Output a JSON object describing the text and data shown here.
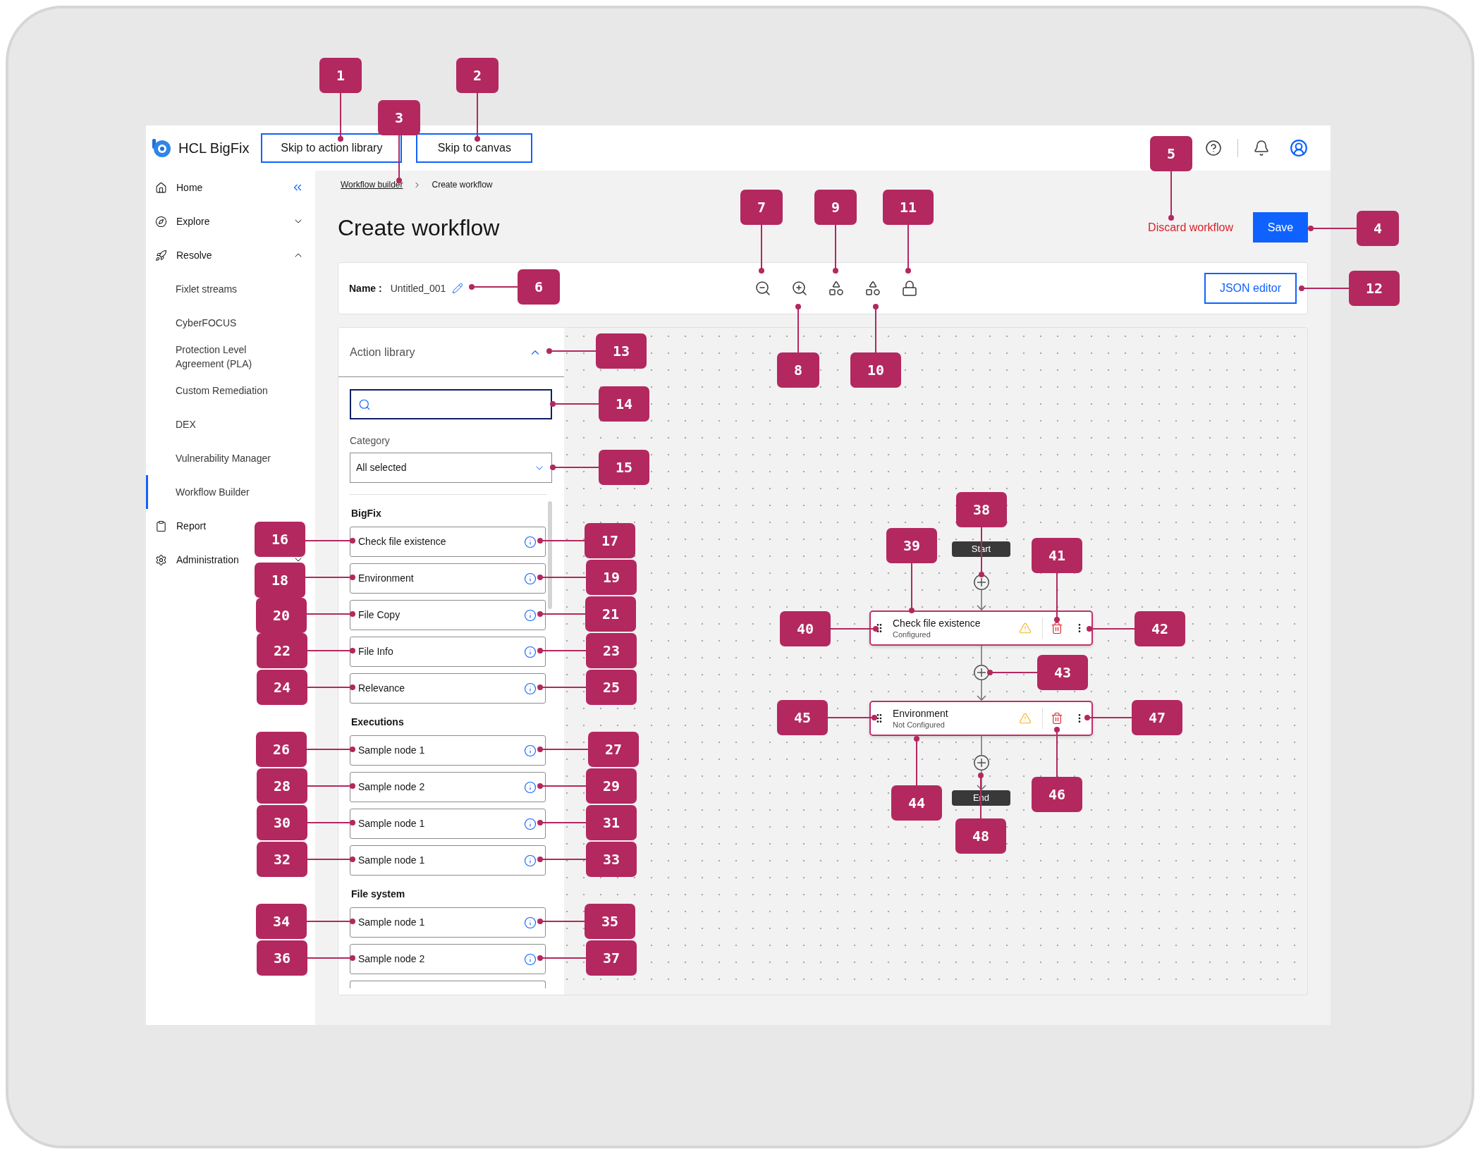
{
  "header": {
    "logo_text": "HCL BigFix",
    "skip_links": [
      {
        "label": "Skip to action library"
      },
      {
        "label": "Skip to canvas"
      }
    ]
  },
  "sidebar": {
    "collapsible": true,
    "items": [
      {
        "label": "Home",
        "kind": "link",
        "selected": false
      },
      {
        "label": "Explore",
        "kind": "group",
        "expanded": false,
        "selected": false
      },
      {
        "label": "Resolve",
        "kind": "group",
        "expanded": true,
        "selected": false,
        "children": [
          {
            "label": "Fixlet streams",
            "selected": false
          },
          {
            "label": "CyberFOCUS",
            "selected": false
          },
          {
            "label": "Protection Level Agreement (PLA)",
            "selected": false
          },
          {
            "label": "Custom Remediation",
            "selected": false
          },
          {
            "label": "DEX",
            "selected": false
          },
          {
            "label": "Vulnerability Manager",
            "selected": false
          },
          {
            "label": "Workflow Builder",
            "selected": true
          }
        ]
      },
      {
        "label": "Report",
        "kind": "link",
        "selected": false
      },
      {
        "label": "Administration",
        "kind": "group",
        "expanded": false,
        "selected": false
      }
    ]
  },
  "breadcrumb": [
    {
      "label": "Workflow builder",
      "current": false
    },
    {
      "label": "Create workflow",
      "current": true
    }
  ],
  "page": {
    "title": "Create workflow",
    "discard": "Discard workflow",
    "save": "Save"
  },
  "toolbar": {
    "name_label": "Name :",
    "name_value": "Untitled_001",
    "json_editor": "JSON editor"
  },
  "action_library": {
    "title": "Action library",
    "expanded": true,
    "category_label": "Category",
    "category_value": "All selected",
    "groups": [
      {
        "title": "BigFix",
        "items": [
          {
            "kind": "action",
            "label": "Check file existence"
          },
          {
            "kind": "action",
            "label": "Environment"
          },
          {
            "kind": "action",
            "label": "File Copy"
          },
          {
            "kind": "action",
            "label": "File Info"
          },
          {
            "kind": "action",
            "label": "Relevance"
          }
        ]
      },
      {
        "title": "Executions",
        "items": [
          {
            "kind": "action",
            "label": "Sample node 1"
          },
          {
            "kind": "action",
            "label": "Sample node 2"
          },
          {
            "kind": "action",
            "label": "Sample node 1"
          },
          {
            "kind": "action",
            "label": "Sample node 1"
          }
        ]
      },
      {
        "title": "File system",
        "items": [
          {
            "kind": "action",
            "label": "Sample node 1"
          },
          {
            "kind": "action",
            "label": "Sample node 2"
          },
          {
            "kind": "cut_off"
          }
        ]
      }
    ]
  },
  "canvas": {
    "start": "Start",
    "nodes": [
      {
        "title": "Check file existence",
        "status": "Configured"
      },
      {
        "title": "Environment",
        "status": "Not Configured"
      }
    ],
    "end": "End"
  },
  "callouts": [
    {
      "number": "1"
    },
    {
      "number": "2"
    },
    {
      "number": "3"
    },
    {
      "number": "4"
    },
    {
      "number": "5"
    },
    {
      "number": "6"
    },
    {
      "number": "7"
    },
    {
      "number": "8"
    },
    {
      "number": "9"
    },
    {
      "number": "10"
    },
    {
      "number": "11"
    },
    {
      "number": "12"
    },
    {
      "number": "13"
    },
    {
      "number": "14"
    },
    {
      "number": "15"
    },
    {
      "number": "16"
    },
    {
      "number": "17"
    },
    {
      "number": "18"
    },
    {
      "number": "19"
    },
    {
      "number": "20"
    },
    {
      "number": "21"
    },
    {
      "number": "22"
    },
    {
      "number": "23"
    },
    {
      "number": "24"
    },
    {
      "number": "25"
    },
    {
      "number": "26"
    },
    {
      "number": "27"
    },
    {
      "number": "28"
    },
    {
      "number": "29"
    },
    {
      "number": "30"
    },
    {
      "number": "31"
    },
    {
      "number": "32"
    },
    {
      "number": "33"
    },
    {
      "number": "34"
    },
    {
      "number": "35"
    },
    {
      "number": "36"
    },
    {
      "number": "37"
    },
    {
      "number": "38"
    },
    {
      "number": "39"
    },
    {
      "number": "40"
    },
    {
      "number": "41"
    },
    {
      "number": "42"
    },
    {
      "number": "43"
    },
    {
      "number": "44"
    },
    {
      "number": "45"
    },
    {
      "number": "46"
    },
    {
      "number": "47"
    },
    {
      "number": "48"
    }
  ]
}
